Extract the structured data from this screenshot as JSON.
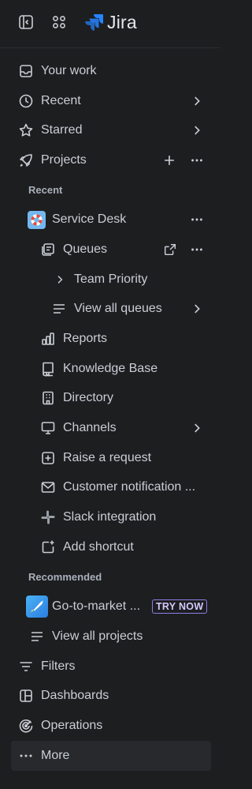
{
  "app": {
    "name": "Jira"
  },
  "nav": {
    "your_work": "Your work",
    "recent": "Recent",
    "starred": "Starred",
    "projects": "Projects",
    "section_recent": "Recent",
    "service_desk": "Service Desk",
    "queues": "Queues",
    "team_priority": "Team Priority",
    "view_all_queues": "View all queues",
    "reports": "Reports",
    "knowledge_base": "Knowledge Base",
    "directory": "Directory",
    "channels": "Channels",
    "raise_request": "Raise a request",
    "customer_notification": "Customer notification ...",
    "slack_integration": "Slack integration",
    "add_shortcut": "Add shortcut",
    "section_recommended": "Recommended",
    "go_to_market": "Go-to-market ...",
    "try_now": "TRY NOW",
    "view_all_projects": "View all projects",
    "filters": "Filters",
    "dashboards": "Dashboards",
    "operations": "Operations",
    "more": "More"
  },
  "colors": {
    "background": "#1d1e20",
    "text": "#c9ced6",
    "jira_blue": "#2684ff",
    "try_now_border": "#8f7ee7"
  }
}
